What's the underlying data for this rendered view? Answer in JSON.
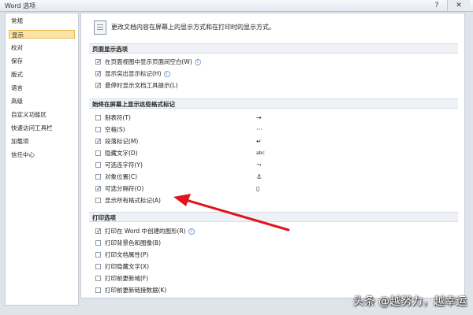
{
  "window": {
    "title": "Word 选项",
    "help_glyph": "?",
    "close_glyph": "✕"
  },
  "sidebar": {
    "items": [
      {
        "label": "常规"
      },
      {
        "label": "显示",
        "selected": true
      },
      {
        "label": "校对"
      },
      {
        "label": "保存"
      },
      {
        "label": "版式"
      },
      {
        "label": "语言"
      },
      {
        "label": "高级"
      },
      {
        "label": "自定义功能区"
      },
      {
        "label": "快速访问工具栏"
      },
      {
        "label": "加载项"
      },
      {
        "label": "信任中心"
      }
    ]
  },
  "main": {
    "header": "更改文档内容在屏幕上的显示方式和在打印时的显示方式。",
    "sections": [
      {
        "title": "页面显示选项",
        "options": [
          {
            "label": "在页面视图中显示页面间空白(W)",
            "checked": true,
            "info": true
          },
          {
            "label": "显示突出显示标记(H)",
            "checked": true,
            "info": true
          },
          {
            "label": "悬停时显示文档工具提示(L)",
            "checked": true,
            "info": false
          }
        ]
      },
      {
        "title": "始终在屏幕上显示这些格式标记",
        "options": [
          {
            "label": "制表符(T)",
            "checked": false,
            "glyph": "→"
          },
          {
            "label": "空格(S)",
            "checked": false,
            "glyph": "···"
          },
          {
            "label": "段落标记(M)",
            "checked": true,
            "glyph": "↵"
          },
          {
            "label": "隐藏文字(D)",
            "checked": false,
            "glyph": "abc"
          },
          {
            "label": "可选连字符(Y)",
            "checked": false,
            "glyph": "¬"
          },
          {
            "label": "对象位置(C)",
            "checked": false,
            "glyph": "⚓"
          },
          {
            "label": "可选分隔符(O)",
            "checked": true,
            "glyph": "▯"
          },
          {
            "label": "显示所有格式标记(A)",
            "checked": false,
            "glyph": ""
          }
        ]
      },
      {
        "title": "打印选项",
        "options": [
          {
            "label": "打印在 Word 中创建的图形(R)",
            "checked": true,
            "info": true
          },
          {
            "label": "打印背景色和图像(B)",
            "checked": false,
            "info": false
          },
          {
            "label": "打印文档属性(P)",
            "checked": false,
            "info": false
          },
          {
            "label": "打印隐藏文字(X)",
            "checked": false,
            "info": false
          },
          {
            "label": "打印前更新域(F)",
            "checked": false,
            "info": false
          },
          {
            "label": "打印前更新链接数据(K)",
            "checked": false,
            "info": false
          }
        ]
      }
    ]
  },
  "watermark": "头条 @越努力，越幸运",
  "colors": {
    "arrow": "#e0141e",
    "selected_bg": "#fbe4a3"
  }
}
